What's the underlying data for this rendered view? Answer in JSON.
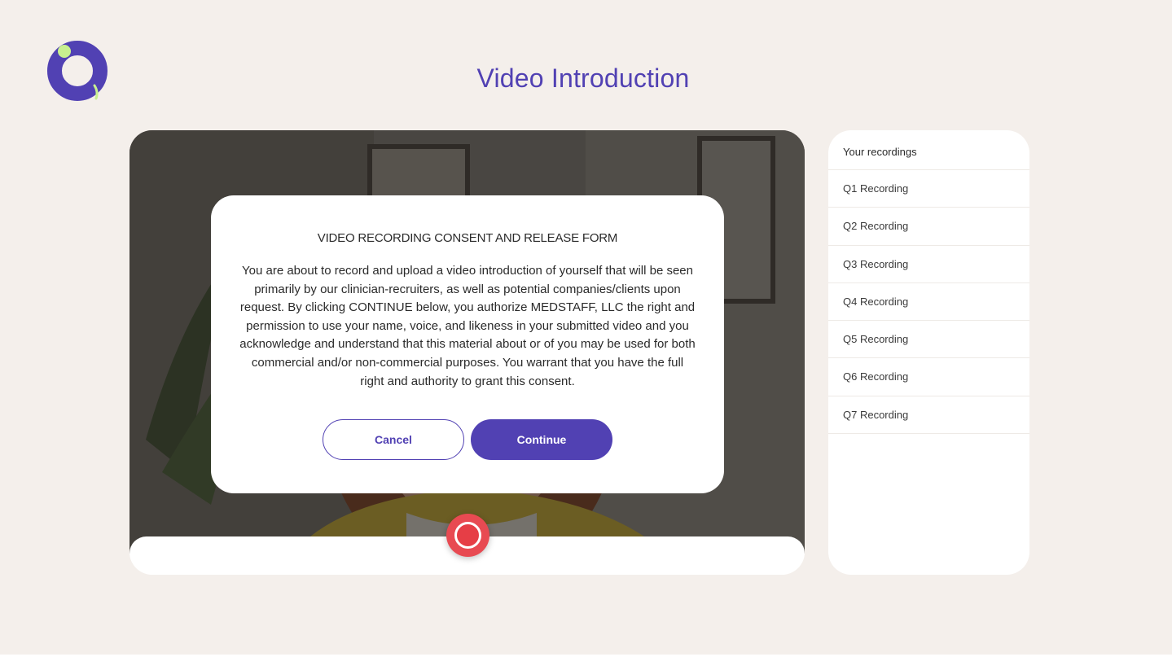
{
  "page": {
    "title": "Video Introduction"
  },
  "colors": {
    "brand": "#5141b3",
    "accent_green": "#c8f08f",
    "record_red": "#e84a52",
    "background": "#f4efeb"
  },
  "icons": {
    "logo": "brand-ring-logo",
    "record": "record-icon"
  },
  "modal": {
    "title": "VIDEO RECORDING CONSENT AND RELEASE FORM",
    "body": "You are about to record and upload a video introduction of yourself that will be seen primarily by our clinician-recruiters, as well as potential companies/clients upon request. By clicking CONTINUE below, you authorize MEDSTAFF, LLC the right and permission to use your name, voice, and likeness in your submitted video and you acknowledge and understand that this material about or of you may be used for both commercial and/or non-commercial purposes. You warrant that you have the full right and authority to grant this consent.",
    "cancel_label": "Cancel",
    "continue_label": "Continue"
  },
  "sidebar": {
    "header": "Your recordings",
    "items": [
      {
        "label": "Q1 Recording"
      },
      {
        "label": "Q2 Recording"
      },
      {
        "label": "Q3 Recording"
      },
      {
        "label": "Q4 Recording"
      },
      {
        "label": "Q5 Recording"
      },
      {
        "label": "Q6 Recording"
      },
      {
        "label": "Q7 Recording"
      }
    ]
  }
}
